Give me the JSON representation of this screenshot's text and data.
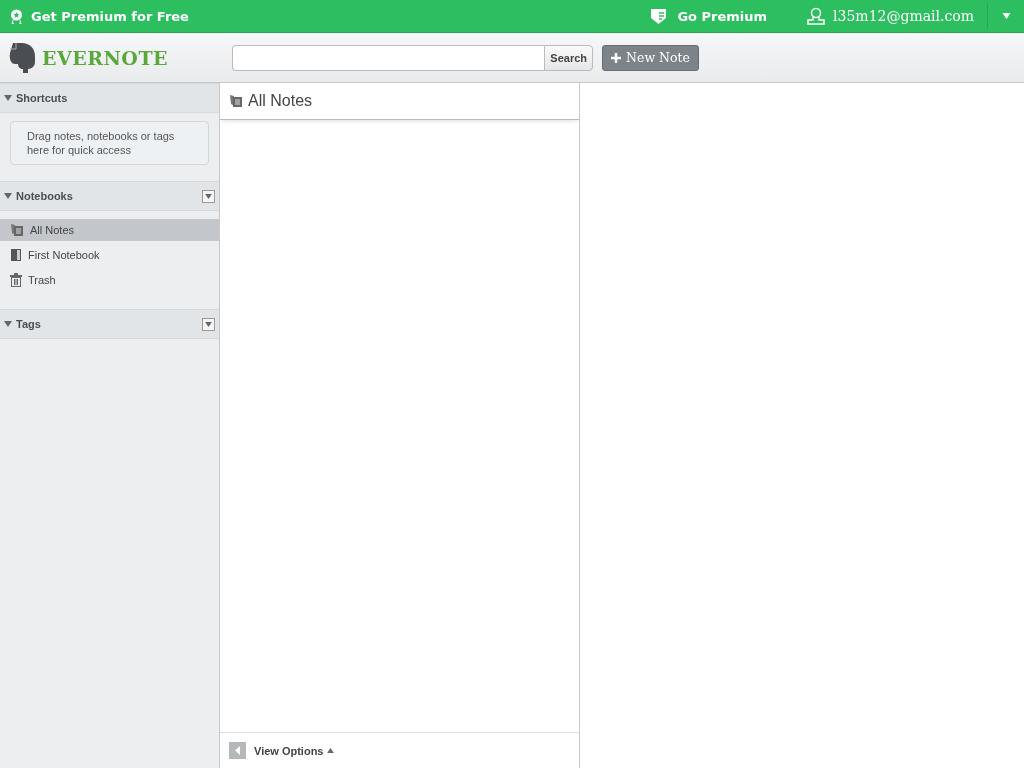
{
  "top_bar": {
    "promo": "Get Premium for Free",
    "go_premium": "Go Premium",
    "account": "l35m12@gmail.com"
  },
  "header": {
    "logo": "EVERNOTE",
    "search": {
      "button": "Search"
    },
    "new_note": "New Note"
  },
  "sidebar": {
    "shortcuts": {
      "title": "Shortcuts",
      "expanded": true,
      "hint": "Drag notes, notebooks or tags here for quick access"
    },
    "notebooks": {
      "title": "Notebooks",
      "expanded": true,
      "items": [
        {
          "label": "All Notes",
          "kind": "notes",
          "selected": true
        },
        {
          "label": "First Notebook",
          "kind": "notebook",
          "selected": false
        },
        {
          "label": "Trash",
          "kind": "trash",
          "selected": false
        }
      ]
    },
    "tags": {
      "title": "Tags",
      "expanded": true
    }
  },
  "note_list": {
    "title": "All Notes",
    "view_options": "View Options"
  }
}
